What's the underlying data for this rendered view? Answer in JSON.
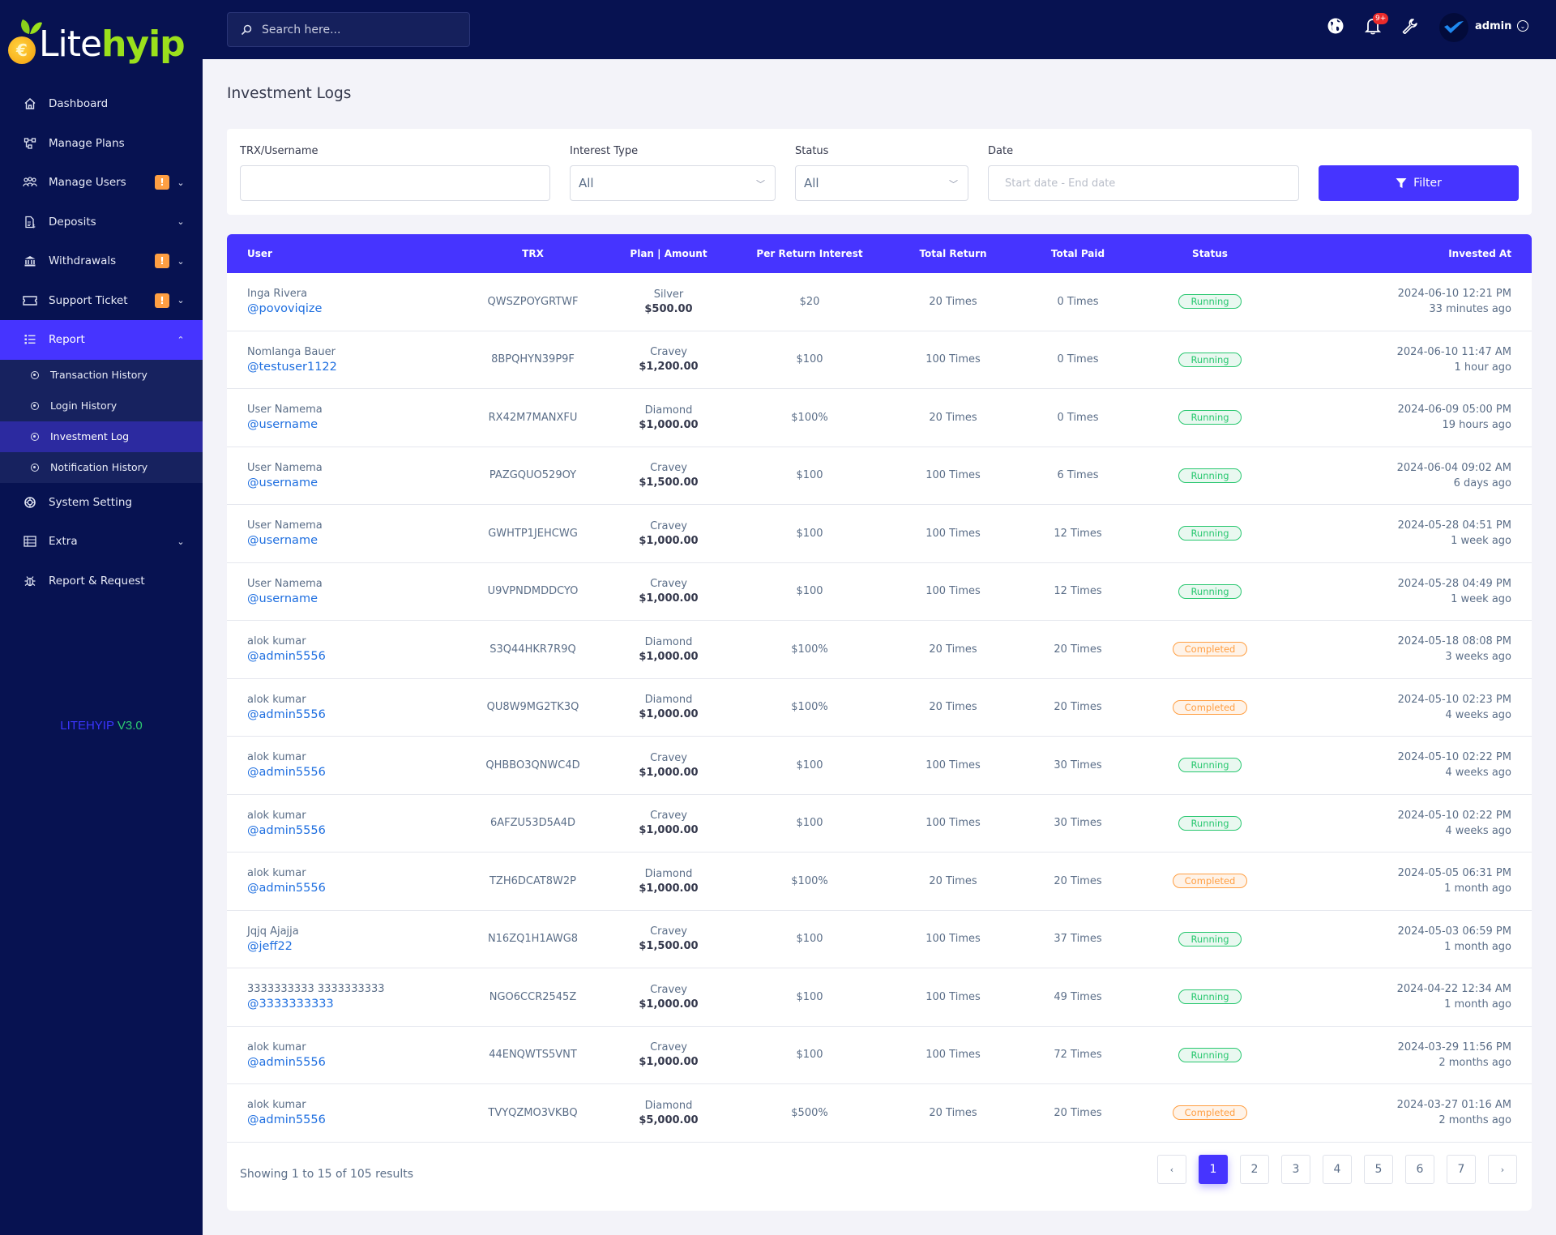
{
  "brand": {
    "lite": "Lite",
    "hyip": "hyip",
    "version_name": "LITEHYIP",
    "version_num": "V3.0"
  },
  "colors": {
    "sidebar_bg": "#071251",
    "accent": "#4634ff",
    "running": "#28c76f",
    "completed": "#ff9f43",
    "link": "#1f6fe0",
    "badge": "#ff9f43"
  },
  "sidebar": {
    "items": [
      {
        "label": "Dashboard",
        "icon": "home-icon",
        "badge": null,
        "chevron": false
      },
      {
        "label": "Manage Plans",
        "icon": "plans-icon",
        "badge": null,
        "chevron": false
      },
      {
        "label": "Manage Users",
        "icon": "users-icon",
        "badge": "!",
        "chevron": true
      },
      {
        "label": "Deposits",
        "icon": "deposit-icon",
        "badge": null,
        "chevron": true
      },
      {
        "label": "Withdrawals",
        "icon": "bank-icon",
        "badge": "!",
        "chevron": true
      },
      {
        "label": "Support Ticket",
        "icon": "ticket-icon",
        "badge": "!",
        "chevron": true
      },
      {
        "label": "Report",
        "icon": "list-icon",
        "badge": null,
        "chevron": true,
        "active": true
      },
      {
        "label": "System Setting",
        "icon": "settings-icon",
        "badge": null,
        "chevron": false
      },
      {
        "label": "Extra",
        "icon": "server-icon",
        "badge": null,
        "chevron": true
      },
      {
        "label": "Report & Request",
        "icon": "bug-icon",
        "badge": null,
        "chevron": false
      }
    ],
    "report_submenu": [
      {
        "label": "Transaction History"
      },
      {
        "label": "Login History"
      },
      {
        "label": "Investment Log",
        "active": true
      },
      {
        "label": "Notification History"
      }
    ]
  },
  "header": {
    "search_placeholder": "Search here...",
    "notification_count": "9+",
    "user_name": "admin"
  },
  "page": {
    "title": "Investment Logs"
  },
  "filters": {
    "trx_label": "TRX/Username",
    "trx_value": "",
    "interest_label": "Interest Type",
    "interest_value": "All",
    "status_label": "Status",
    "status_value": "All",
    "date_label": "Date",
    "date_placeholder": "Start date - End date",
    "filter_button": "Filter"
  },
  "table": {
    "columns": [
      "User",
      "TRX",
      "Plan | Amount",
      "Per Return Interest",
      "Total Return",
      "Total Paid",
      "Status",
      "Invested At"
    ],
    "rows": [
      {
        "name": "Inga Rivera",
        "handle": "@povoviqize",
        "trx": "QWSZPOYGRTWF",
        "plan": "Silver",
        "amount": "$500.00",
        "interest": "$20",
        "total_return": "20 Times",
        "total_paid": "0 Times",
        "status": "Running",
        "date": "2024-06-10 12:21 PM",
        "ago": "33 minutes ago"
      },
      {
        "name": "Nomlanga Bauer",
        "handle": "@testuser1122",
        "trx": "8BPQHYN39P9F",
        "plan": "Cravey",
        "amount": "$1,200.00",
        "interest": "$100",
        "total_return": "100 Times",
        "total_paid": "0 Times",
        "status": "Running",
        "date": "2024-06-10 11:47 AM",
        "ago": "1 hour ago"
      },
      {
        "name": "User Namema",
        "handle": "@username",
        "trx": "RX42M7MANXFU",
        "plan": "Diamond",
        "amount": "$1,000.00",
        "interest": "$100%",
        "total_return": "20 Times",
        "total_paid": "0 Times",
        "status": "Running",
        "date": "2024-06-09 05:00 PM",
        "ago": "19 hours ago"
      },
      {
        "name": "User Namema",
        "handle": "@username",
        "trx": "PAZGQUO529OY",
        "plan": "Cravey",
        "amount": "$1,500.00",
        "interest": "$100",
        "total_return": "100 Times",
        "total_paid": "6 Times",
        "status": "Running",
        "date": "2024-06-04 09:02 AM",
        "ago": "6 days ago"
      },
      {
        "name": "User Namema",
        "handle": "@username",
        "trx": "GWHTP1JEHCWG",
        "plan": "Cravey",
        "amount": "$1,000.00",
        "interest": "$100",
        "total_return": "100 Times",
        "total_paid": "12 Times",
        "status": "Running",
        "date": "2024-05-28 04:51 PM",
        "ago": "1 week ago"
      },
      {
        "name": "User Namema",
        "handle": "@username",
        "trx": "U9VPNDMDDCYO",
        "plan": "Cravey",
        "amount": "$1,000.00",
        "interest": "$100",
        "total_return": "100 Times",
        "total_paid": "12 Times",
        "status": "Running",
        "date": "2024-05-28 04:49 PM",
        "ago": "1 week ago"
      },
      {
        "name": "alok kumar",
        "handle": "@admin5556",
        "trx": "S3Q44HKR7R9Q",
        "plan": "Diamond",
        "amount": "$1,000.00",
        "interest": "$100%",
        "total_return": "20 Times",
        "total_paid": "20 Times",
        "status": "Completed",
        "date": "2024-05-18 08:08 PM",
        "ago": "3 weeks ago"
      },
      {
        "name": "alok kumar",
        "handle": "@admin5556",
        "trx": "QU8W9MG2TK3Q",
        "plan": "Diamond",
        "amount": "$1,000.00",
        "interest": "$100%",
        "total_return": "20 Times",
        "total_paid": "20 Times",
        "status": "Completed",
        "date": "2024-05-10 02:23 PM",
        "ago": "4 weeks ago"
      },
      {
        "name": "alok kumar",
        "handle": "@admin5556",
        "trx": "QHBBO3QNWC4D",
        "plan": "Cravey",
        "amount": "$1,000.00",
        "interest": "$100",
        "total_return": "100 Times",
        "total_paid": "30 Times",
        "status": "Running",
        "date": "2024-05-10 02:22 PM",
        "ago": "4 weeks ago"
      },
      {
        "name": "alok kumar",
        "handle": "@admin5556",
        "trx": "6AFZU53D5A4D",
        "plan": "Cravey",
        "amount": "$1,000.00",
        "interest": "$100",
        "total_return": "100 Times",
        "total_paid": "30 Times",
        "status": "Running",
        "date": "2024-05-10 02:22 PM",
        "ago": "4 weeks ago"
      },
      {
        "name": "alok kumar",
        "handle": "@admin5556",
        "trx": "TZH6DCAT8W2P",
        "plan": "Diamond",
        "amount": "$1,000.00",
        "interest": "$100%",
        "total_return": "20 Times",
        "total_paid": "20 Times",
        "status": "Completed",
        "date": "2024-05-05 06:31 PM",
        "ago": "1 month ago"
      },
      {
        "name": "Jqjq Ajajja",
        "handle": "@jeff22",
        "trx": "N16ZQ1H1AWG8",
        "plan": "Cravey",
        "amount": "$1,500.00",
        "interest": "$100",
        "total_return": "100 Times",
        "total_paid": "37 Times",
        "status": "Running",
        "date": "2024-05-03 06:59 PM",
        "ago": "1 month ago"
      },
      {
        "name": "3333333333 3333333333",
        "handle": "@3333333333",
        "trx": "NGO6CCR2545Z",
        "plan": "Cravey",
        "amount": "$1,000.00",
        "interest": "$100",
        "total_return": "100 Times",
        "total_paid": "49 Times",
        "status": "Running",
        "date": "2024-04-22 12:34 AM",
        "ago": "1 month ago"
      },
      {
        "name": "alok kumar",
        "handle": "@admin5556",
        "trx": "44ENQWTS5VNT",
        "plan": "Cravey",
        "amount": "$1,000.00",
        "interest": "$100",
        "total_return": "100 Times",
        "total_paid": "72 Times",
        "status": "Running",
        "date": "2024-03-29 11:56 PM",
        "ago": "2 months ago"
      },
      {
        "name": "alok kumar",
        "handle": "@admin5556",
        "trx": "TVYQZMO3VKBQ",
        "plan": "Diamond",
        "amount": "$5,000.00",
        "interest": "$500%",
        "total_return": "20 Times",
        "total_paid": "20 Times",
        "status": "Completed",
        "date": "2024-03-27 01:16 AM",
        "ago": "2 months ago"
      }
    ]
  },
  "pagination": {
    "summary": "Showing 1 to 15 of 105 results",
    "prev": "‹",
    "next": "›",
    "pages": [
      "1",
      "2",
      "3",
      "4",
      "5",
      "6",
      "7"
    ],
    "current": "1"
  }
}
